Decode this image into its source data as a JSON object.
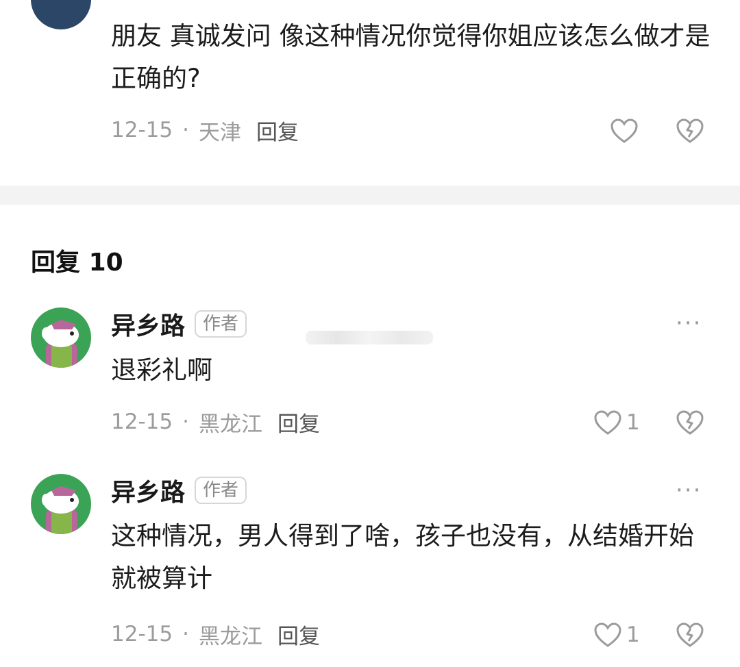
{
  "main_comment": {
    "text": "朋友 真诚发问 像这种情况你觉得你姐应该怎么做才是正确的?",
    "date": "12-15",
    "location": "天津",
    "reply_label": "回复"
  },
  "replies_header": {
    "label": "回复",
    "count": "10"
  },
  "replies": [
    {
      "name": "异乡路",
      "badge": "作者",
      "text": "退彩礼啊",
      "date": "12-15",
      "location": "黑龙江",
      "reply_label": "回复",
      "like_count": "1"
    },
    {
      "name": "异乡路",
      "badge": "作者",
      "text": "这种情况，男人得到了啥，孩子也没有，从结婚开始就被算计",
      "date": "12-15",
      "location": "黑龙江",
      "reply_label": "回复",
      "like_count": "1"
    }
  ],
  "ui": {
    "separator": "·",
    "more_glyph": "···"
  },
  "icons": {
    "like": "heart-outline-icon",
    "dislike": "broken-heart-icon"
  },
  "colors": {
    "meta_gray": "#9b9b9b",
    "divider_band": "#f3f3f3",
    "avatar_green": "#3aa356"
  }
}
